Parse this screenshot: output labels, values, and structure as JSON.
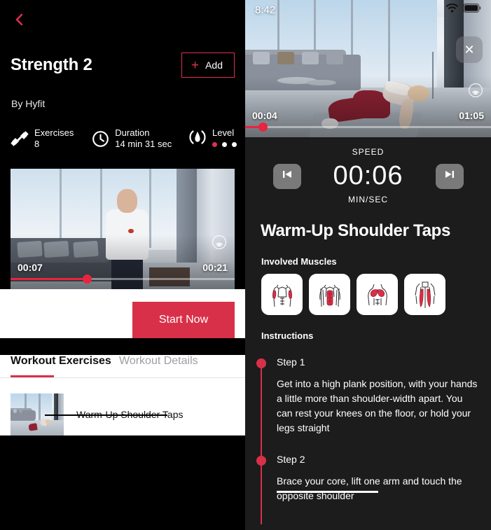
{
  "left": {
    "back_icon": "chevron-left-icon",
    "title": "Strength 2",
    "add_label": "Add",
    "add_icon": "plus-icon",
    "by_line": "By Hyfit",
    "stats": [
      {
        "key": "Exercises",
        "value": "8",
        "icon": "dumbbell-icon"
      },
      {
        "key": "Duration",
        "value": "14 min 31 sec",
        "icon": "clock-icon"
      },
      {
        "key": "Level",
        "value": "",
        "icon": "flame-icon",
        "dots_total": 3,
        "dots_active": 1
      }
    ],
    "video": {
      "current_time": "00:07",
      "total_time": "00:21",
      "progress_pct": 34,
      "airplay_icon": "airplay-icon"
    },
    "start_label": "Start Now",
    "tabs": [
      {
        "label": "Workout Exercises",
        "active": true
      },
      {
        "label": "Workout Details",
        "active": false
      }
    ],
    "exercises": [
      {
        "name": "Warm-Up Shoulder Taps"
      }
    ]
  },
  "right": {
    "statusbar": {
      "clock": "8:42",
      "wifi_icon": "wifi-icon",
      "battery_icon": "battery-icon"
    },
    "close_icon": "close-icon",
    "video": {
      "current_time": "00:04",
      "total_time": "01:05",
      "progress_pct": 7,
      "airplay_icon": "airplay-icon"
    },
    "speed_label": "SPEED",
    "timer_value": "00:06",
    "unit_label": "MIN/SEC",
    "prev_icon": "skip-previous-icon",
    "next_icon": "skip-next-icon",
    "exercise_title": "Warm-Up Shoulder Taps",
    "muscles_heading": "Involved Muscles",
    "muscles": [
      {
        "name": "biceps"
      },
      {
        "name": "abdominals"
      },
      {
        "name": "chest"
      },
      {
        "name": "quadriceps"
      }
    ],
    "instructions_heading": "Instructions",
    "steps": [
      {
        "label": "Step 1",
        "text": "Get into a high plank position, with your hands a little more than shoulder-width apart. You can rest your knees on the floor, or hold your legs straight"
      },
      {
        "label": "Step 2",
        "text": "Brace your core, lift one arm and touch the opposite shoulder"
      }
    ]
  },
  "colors": {
    "accent_red": "#d93049",
    "seek_red": "#e8243f",
    "dark_bg": "#1c1c1c",
    "black": "#000000",
    "white": "#ffffff"
  }
}
